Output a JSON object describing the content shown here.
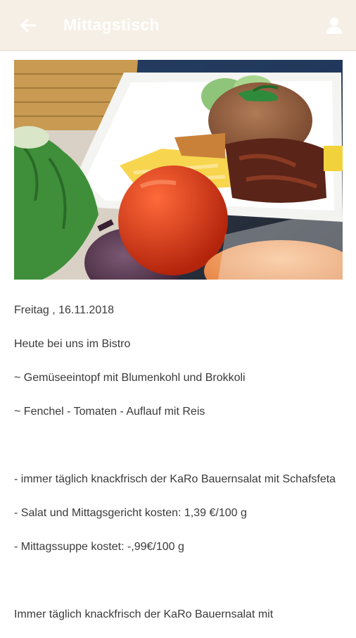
{
  "header": {
    "title": "Mittagstisch",
    "back_icon": "arrow-left-icon",
    "profile_icon": "user-icon",
    "background": "#f6efe5"
  },
  "hero_image": {
    "alt": "",
    "icon": "food-plate-image"
  },
  "article": {
    "date": "Freitag , 16.11.2018",
    "intro": "Heute bei uns im Bistro",
    "dish_1": "~ Gemüseeintopf mit Blumenkohl und Brokkoli",
    "dish_2": "~ Fenchel - Tomaten - Auflauf mit Reis",
    "salad": "- immer täglich knackfrisch der KaRo Bauernsalat mit Schafsfeta",
    "price_main": "- Salat und Mittagsgericht kosten: 1,39 €/100 g",
    "price_soup": "- Mittagssuppe kostet: -,99€/100 g",
    "trailing": "Immer täglich knackfrisch der KaRo Bauernsalat mit"
  }
}
